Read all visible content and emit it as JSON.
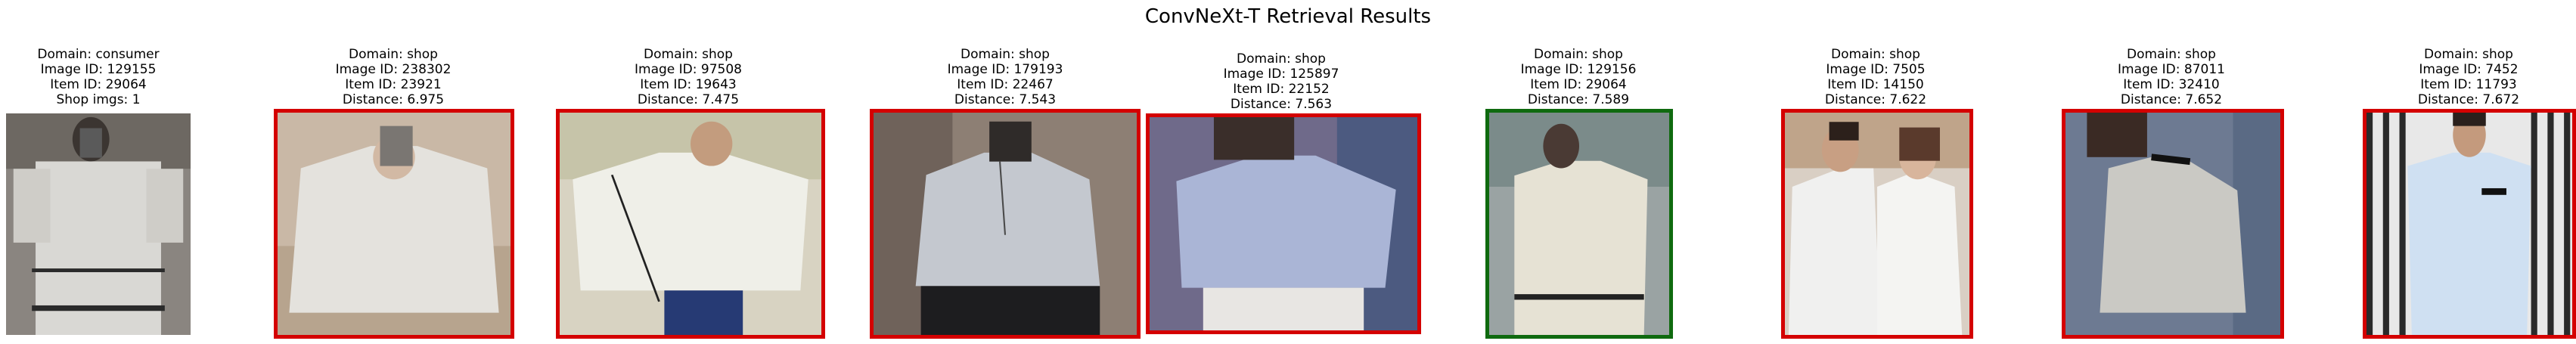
{
  "figure": {
    "title": "ConvNeXt-T Retrieval Results"
  },
  "query": {
    "domain": "Domain: consumer",
    "image_id": "Image ID: 129155",
    "item_id": "Item ID: 29064",
    "shop_imgs": "Shop imgs: 1"
  },
  "results": [
    {
      "domain": "Domain: shop",
      "image_id": "Image ID: 238302",
      "item_id": "Item ID: 23921",
      "distance": "Distance: 6.975",
      "match": false
    },
    {
      "domain": "Domain: shop",
      "image_id": "Image ID: 97508",
      "item_id": "Item ID: 19643",
      "distance": "Distance: 7.475",
      "match": false
    },
    {
      "domain": "Domain: shop",
      "image_id": "Image ID: 179193",
      "item_id": "Item ID: 22467",
      "distance": "Distance: 7.543",
      "match": false
    },
    {
      "domain": "Domain: shop",
      "image_id": "Image ID: 125897",
      "item_id": "Item ID: 22152",
      "distance": "Distance: 7.563",
      "match": false
    },
    {
      "domain": "Domain: shop",
      "image_id": "Image ID: 129156",
      "item_id": "Item ID: 29064",
      "distance": "Distance: 7.589",
      "match": true
    },
    {
      "domain": "Domain: shop",
      "image_id": "Image ID: 7505",
      "item_id": "Item ID: 14150",
      "distance": "Distance: 7.622",
      "match": false
    },
    {
      "domain": "Domain: shop",
      "image_id": "Image ID: 87011",
      "item_id": "Item ID: 32410",
      "distance": "Distance: 7.652",
      "match": false
    },
    {
      "domain": "Domain: shop",
      "image_id": "Image ID: 7452",
      "item_id": "Item ID: 11793",
      "distance": "Distance: 7.672",
      "match": false
    }
  ],
  "colors": {
    "match_border": "#0f6a0f",
    "mismatch_border": "#d40000"
  }
}
